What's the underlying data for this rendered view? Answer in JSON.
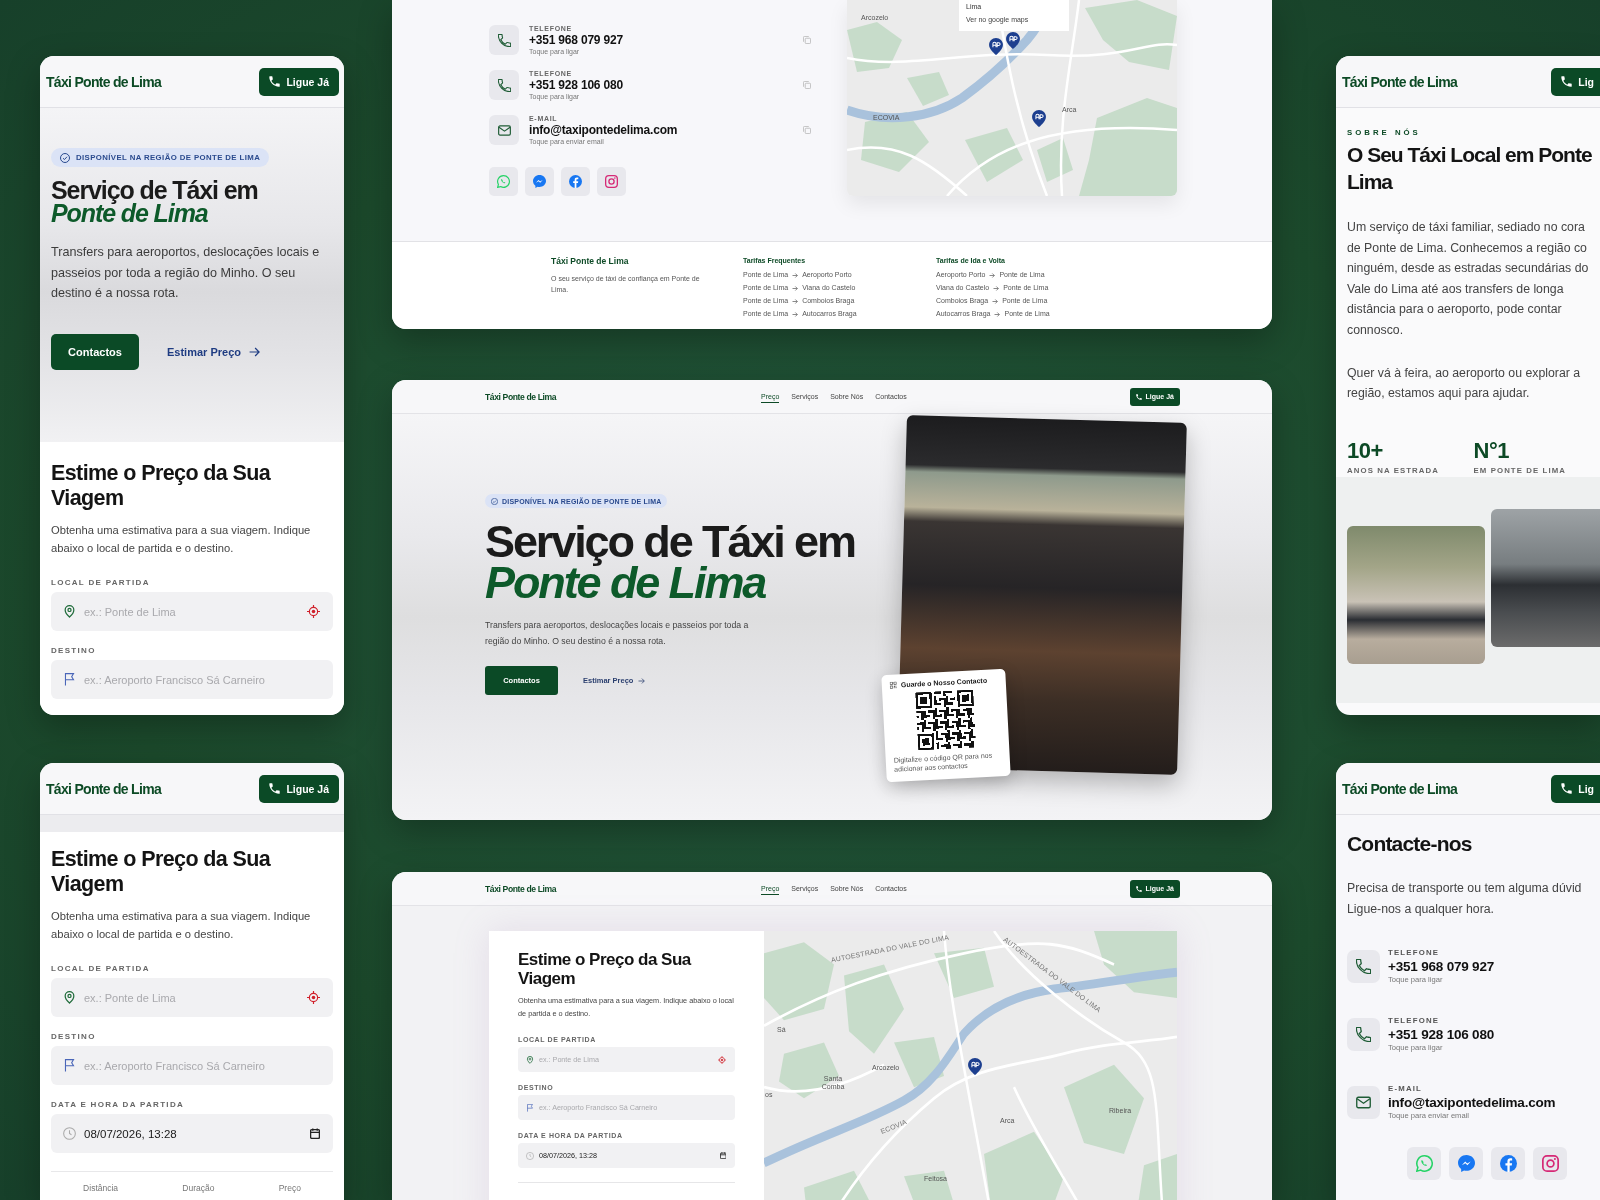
{
  "mobile_hero": {
    "header": {
      "logo": "Táxi Ponte de Lima",
      "call_button": "Ligue Já"
    },
    "badge": "DISPONÍVEL NA REGIÃO DE PONTE DE LIMA",
    "title": "Serviço de Táxi em",
    "title_accent": "Ponte de Lima",
    "text": "Transfers para aeroportos, deslocações locais e passeios por toda a região do Minho. O seu destino é a nossa rota.",
    "primary_button": "Contactos",
    "link": "Estimar Preço",
    "estimate": {
      "title": "Estime o Preço da Sua Viagem",
      "text": "Obtenha uma estimativa para a sua viagem. Indique abaixo o local de partida e o destino.",
      "fields": [
        {
          "kind": "location",
          "label": "LOCAL DE PARTIDA",
          "placeholder": "ex.: Ponte de Lima"
        },
        {
          "kind": "destination",
          "label": "DESTINO",
          "placeholder": "ex.: Aeroporto Francisco Sá Carneiro"
        }
      ]
    }
  },
  "mobile_estimate": {
    "header": {
      "logo": "Táxi Ponte de Lima",
      "call_button": "Ligue Já"
    },
    "title": "Estime o Preço da Sua Viagem",
    "text": "Obtenha uma estimativa para a sua viagem. Indique abaixo o local de partida e o destino.",
    "fields": [
      {
        "kind": "location",
        "label": "LOCAL DE PARTIDA",
        "placeholder": "ex.: Ponte de Lima"
      },
      {
        "kind": "destination",
        "label": "DESTINO",
        "placeholder": "ex.: Aeroporto Francisco Sá Carneiro"
      },
      {
        "kind": "datetime",
        "label": "DATA E HORA DA PARTIDA",
        "value": "08/07/2026, 13:28"
      }
    ],
    "results": [
      "Distância",
      "Duração",
      "Preço"
    ]
  },
  "desktop_contacts": {
    "contacts": [
      {
        "kind": "phone",
        "label": "TELEFONE",
        "value": "+351 968 079 927",
        "hint": "Toque para ligar"
      },
      {
        "kind": "phone",
        "label": "TELEFONE",
        "value": "+351 928 106 080",
        "hint": "Toque para ligar"
      },
      {
        "kind": "email",
        "label": "E-MAIL",
        "value": "info@taxipontedelima.com",
        "hint": "Toque para enviar email"
      }
    ],
    "map": {
      "popup": {
        "title": "Lima",
        "link": "Ver no google maps"
      },
      "places": [
        "Arcozelo",
        "ECOVIA",
        "Arca"
      ]
    },
    "footer": {
      "brand": "Táxi Ponte de Lima",
      "tagline": "O seu serviço de táxi de confiança em Ponte de Lima.",
      "columns": [
        {
          "title": "Tarifas Frequentes",
          "routes": [
            {
              "from": "Ponte de Lima",
              "to": "Aeroporto Porto"
            },
            {
              "from": "Ponte de Lima",
              "to": "Viana do Castelo"
            },
            {
              "from": "Ponte de Lima",
              "to": "Comboios Braga"
            },
            {
              "from": "Ponte de Lima",
              "to": "Autocarros Braga"
            }
          ]
        },
        {
          "title": "Tarifas de Ida e Volta",
          "routes": [
            {
              "from": "Aeroporto Porto",
              "to": "Ponte de Lima"
            },
            {
              "from": "Viana do Castelo",
              "to": "Ponte de Lima"
            },
            {
              "from": "Comboios Braga",
              "to": "Ponte de Lima"
            },
            {
              "from": "Autocarros Braga",
              "to": "Ponte de Lima"
            }
          ]
        }
      ]
    }
  },
  "desktop_hero": {
    "nav": {
      "logo": "Táxi Ponte de Lima",
      "links": [
        {
          "label": "Preço",
          "selected": true
        },
        {
          "label": "Serviços",
          "selected": false
        },
        {
          "label": "Sobre Nós",
          "selected": false
        },
        {
          "label": "Contactos",
          "selected": false
        }
      ],
      "call_button": "Ligue Já"
    },
    "badge": "DISPONÍVEL NA REGIÃO DE PONTE DE LIMA",
    "title": "Serviço de Táxi em",
    "title_accent": "Ponte de Lima",
    "text": "Transfers para aeroportos, deslocações locais e passeios por toda a região do Minho. O seu destino é a nossa rota.",
    "primary_button": "Contactos",
    "link": "Estimar Preço",
    "qr_card": {
      "title": "Guarde o Nosso Contacto",
      "text": "Digitalize o código QR para nos adicionar aos contactos"
    }
  },
  "desktop_estimate": {
    "nav": {
      "logo": "Táxi Ponte de Lima",
      "links": [
        {
          "label": "Preço",
          "selected": true
        },
        {
          "label": "Serviços",
          "selected": false
        },
        {
          "label": "Sobre Nós",
          "selected": false
        },
        {
          "label": "Contactos",
          "selected": false
        }
      ],
      "call_button": "Ligue Já"
    },
    "title": "Estime o Preço da Sua Viagem",
    "text": "Obtenha uma estimativa para a sua viagem. Indique abaixo o local de partida e o destino.",
    "fields": [
      {
        "kind": "location",
        "label": "LOCAL DE PARTIDA",
        "placeholder": "ex.: Ponte de Lima"
      },
      {
        "kind": "destination",
        "label": "DESTINO",
        "placeholder": "ex.: Aeroporto Francisco Sá Carneiro"
      },
      {
        "kind": "datetime",
        "label": "DATA E HORA DA PARTIDA",
        "value": "08/07/2026, 13:28"
      }
    ],
    "map": {
      "places": [
        "AUTOESTRADA DO VALE DO LIMA",
        "AUTOESTRADA DO VALE DO LIMA",
        "Sá",
        "Arcozelo",
        "Santa Comba",
        "ECOVIA",
        "Arca",
        "Ribeira",
        "Feitosa",
        "os"
      ]
    }
  },
  "mobile_about": {
    "header": {
      "logo": "Táxi Ponte de Lima",
      "call_button": "Lig"
    },
    "eyebrow": "SOBRE NÓS",
    "title_lines": [
      "O Seu Táxi Local em Ponte",
      "Lima"
    ],
    "paragraphs": [
      [
        "Um serviço de táxi familiar, sediado no cora",
        "de Ponte de Lima. Conhecemos a região co",
        "ninguém, desde as estradas secundárias do",
        "Vale do Lima até aos transfers de longa",
        "distância para o aeroporto, pode contar",
        "connosco."
      ],
      [
        "Quer vá à feira, ao aeroporto ou explorar a",
        "região, estamos aqui para ajudar."
      ]
    ],
    "stats": [
      {
        "value": "10+",
        "label": "ANOS NA ESTRADA"
      },
      {
        "value": "N°1",
        "label": "EM PONTE DE LIMA"
      }
    ]
  },
  "mobile_contacts": {
    "header": {
      "logo": "Táxi Ponte de Lima",
      "call_button": "Lig"
    },
    "title": "Contacte-nos",
    "text_lines": [
      "Precisa de transporte ou tem alguma dúvid",
      "Ligue-nos a qualquer hora."
    ],
    "contacts": [
      {
        "kind": "phone",
        "label": "TELEFONE",
        "value": "+351 968 079 927",
        "hint": "Toque para ligar"
      },
      {
        "kind": "phone",
        "label": "TELEFONE",
        "value": "+351 928 106 080",
        "hint": "Toque para ligar"
      },
      {
        "kind": "email",
        "label": "E-MAIL",
        "value": "info@taxipontedelima.com",
        "hint": "Toque para enviar email"
      }
    ]
  }
}
